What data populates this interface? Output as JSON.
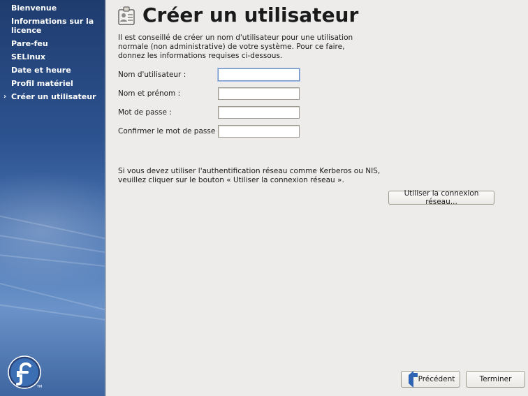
{
  "sidebar": {
    "items": [
      {
        "label": "Bienvenue",
        "current": false
      },
      {
        "label": "Informations sur la licence",
        "current": false
      },
      {
        "label": "Pare-feu",
        "current": false
      },
      {
        "label": "SELinux",
        "current": false
      },
      {
        "label": "Date et heure",
        "current": false
      },
      {
        "label": "Profil matériel",
        "current": false
      },
      {
        "label": "Créer un utilisateur",
        "current": true
      }
    ],
    "current_marker": "›",
    "logo_tm": "TM"
  },
  "page": {
    "title": "Créer un utilisateur",
    "intro": "Il est conseillé de créer un nom d'utilisateur pour une utilisation normale (non administrative) de votre système. Pour ce faire, donnez les informations requises ci-dessous.",
    "fields": [
      {
        "label": "Nom d'utilisateur :",
        "value": "",
        "focused": true
      },
      {
        "label": "Nom et prénom :",
        "value": "",
        "focused": false
      },
      {
        "label": "Mot de passe :",
        "value": "",
        "focused": false
      },
      {
        "label": "Confirmer le mot de passe :",
        "value": "",
        "focused": false
      }
    ],
    "network_text": "Si vous devez utiliser l'authentification réseau comme Kerberos ou NIS, veuillez cliquer sur le bouton « Utiliser la connexion réseau ».",
    "network_button": "Utiliser la connexion réseau..."
  },
  "footer": {
    "back_label": "Précédent",
    "finish_label": "Terminer"
  },
  "colors": {
    "sidebar_top": "#1f3c6e",
    "sidebar_mid": "#4a75b3",
    "background": "#edeceb",
    "focus": "#6b8fc7"
  }
}
